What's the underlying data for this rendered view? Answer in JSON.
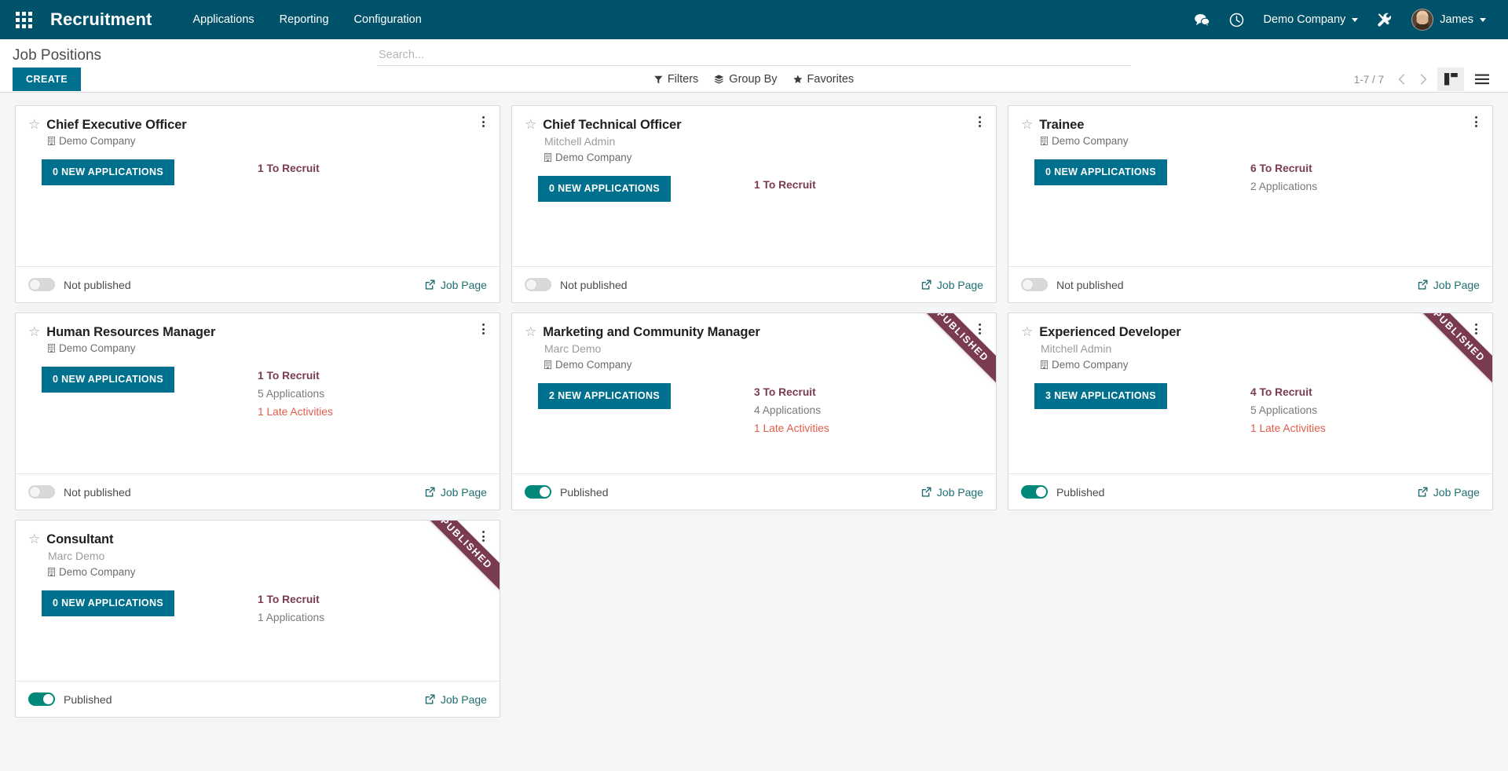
{
  "navbar": {
    "apps_icon": "apps-grid-icon",
    "brand": "Recruitment",
    "menus": [
      {
        "label": "Applications"
      },
      {
        "label": "Reporting"
      },
      {
        "label": "Configuration"
      }
    ],
    "messages_icon": "messages-icon",
    "activities_icon": "clock-icon",
    "company": "Demo Company",
    "debug_icon": "tools-icon",
    "user": "James",
    "bg_color": "#00526B"
  },
  "control_panel": {
    "title": "Job Positions",
    "create_label": "CREATE",
    "search": {
      "placeholder": "Search...",
      "value": ""
    },
    "search_icon": "search-icon",
    "filters_label": "Filters",
    "group_by_label": "Group By",
    "favorites_label": "Favorites",
    "pager": "1-7 / 7",
    "prev_icon": "chevron-left-icon",
    "next_icon": "chevron-right-icon",
    "kanban_view_icon": "kanban-view-icon",
    "list_view_icon": "list-view-icon",
    "active_view": "kanban"
  },
  "labels": {
    "job_page": "Job Page",
    "published": "Published",
    "not_published": "Not published",
    "ribbon": "PUBLISHED",
    "star_icon": "star-outline-icon",
    "manage_icon": "vertical-dots-icon",
    "company_icon": "building-icon",
    "external_link_icon": "external-link-icon"
  },
  "colors": {
    "primary": "#00708F",
    "navbar": "#00526B",
    "toggle_on": "#00897B",
    "recruit": "#7a3b52",
    "late": "#e05c4a",
    "ribbon": "#7a3b52"
  },
  "cards": [
    {
      "title": "Chief Executive Officer",
      "manager": "",
      "company": "Demo Company",
      "applications_button": "0 NEW APPLICATIONS",
      "to_recruit": "1 To Recruit",
      "applications": "",
      "late_activities": "",
      "published": false,
      "publish_label": "Not published"
    },
    {
      "title": "Chief Technical Officer",
      "manager": "Mitchell Admin",
      "company": "Demo Company",
      "applications_button": "0 NEW APPLICATIONS",
      "to_recruit": "1 To Recruit",
      "applications": "",
      "late_activities": "",
      "published": false,
      "publish_label": "Not published"
    },
    {
      "title": "Trainee",
      "manager": "",
      "company": "Demo Company",
      "applications_button": "0 NEW APPLICATIONS",
      "to_recruit": "6 To Recruit",
      "applications": "2 Applications",
      "late_activities": "",
      "published": false,
      "publish_label": "Not published"
    },
    {
      "title": "Human Resources Manager",
      "manager": "",
      "company": "Demo Company",
      "applications_button": "0 NEW APPLICATIONS",
      "to_recruit": "1 To Recruit",
      "applications": "5 Applications",
      "late_activities": "1 Late Activities",
      "published": false,
      "publish_label": "Not published"
    },
    {
      "title": "Marketing and Community Manager",
      "manager": "Marc Demo",
      "company": "Demo Company",
      "applications_button": "2 NEW APPLICATIONS",
      "to_recruit": "3 To Recruit",
      "applications": "4 Applications",
      "late_activities": "1 Late Activities",
      "published": true,
      "publish_label": "Published"
    },
    {
      "title": "Experienced Developer",
      "manager": "Mitchell Admin",
      "company": "Demo Company",
      "applications_button": "3 NEW APPLICATIONS",
      "to_recruit": "4 To Recruit",
      "applications": "5 Applications",
      "late_activities": "1 Late Activities",
      "published": true,
      "publish_label": "Published"
    },
    {
      "title": "Consultant",
      "manager": "Marc Demo",
      "company": "Demo Company",
      "applications_button": "0 NEW APPLICATIONS",
      "to_recruit": "1 To Recruit",
      "applications": "1 Applications",
      "late_activities": "",
      "published": true,
      "publish_label": "Published"
    }
  ]
}
